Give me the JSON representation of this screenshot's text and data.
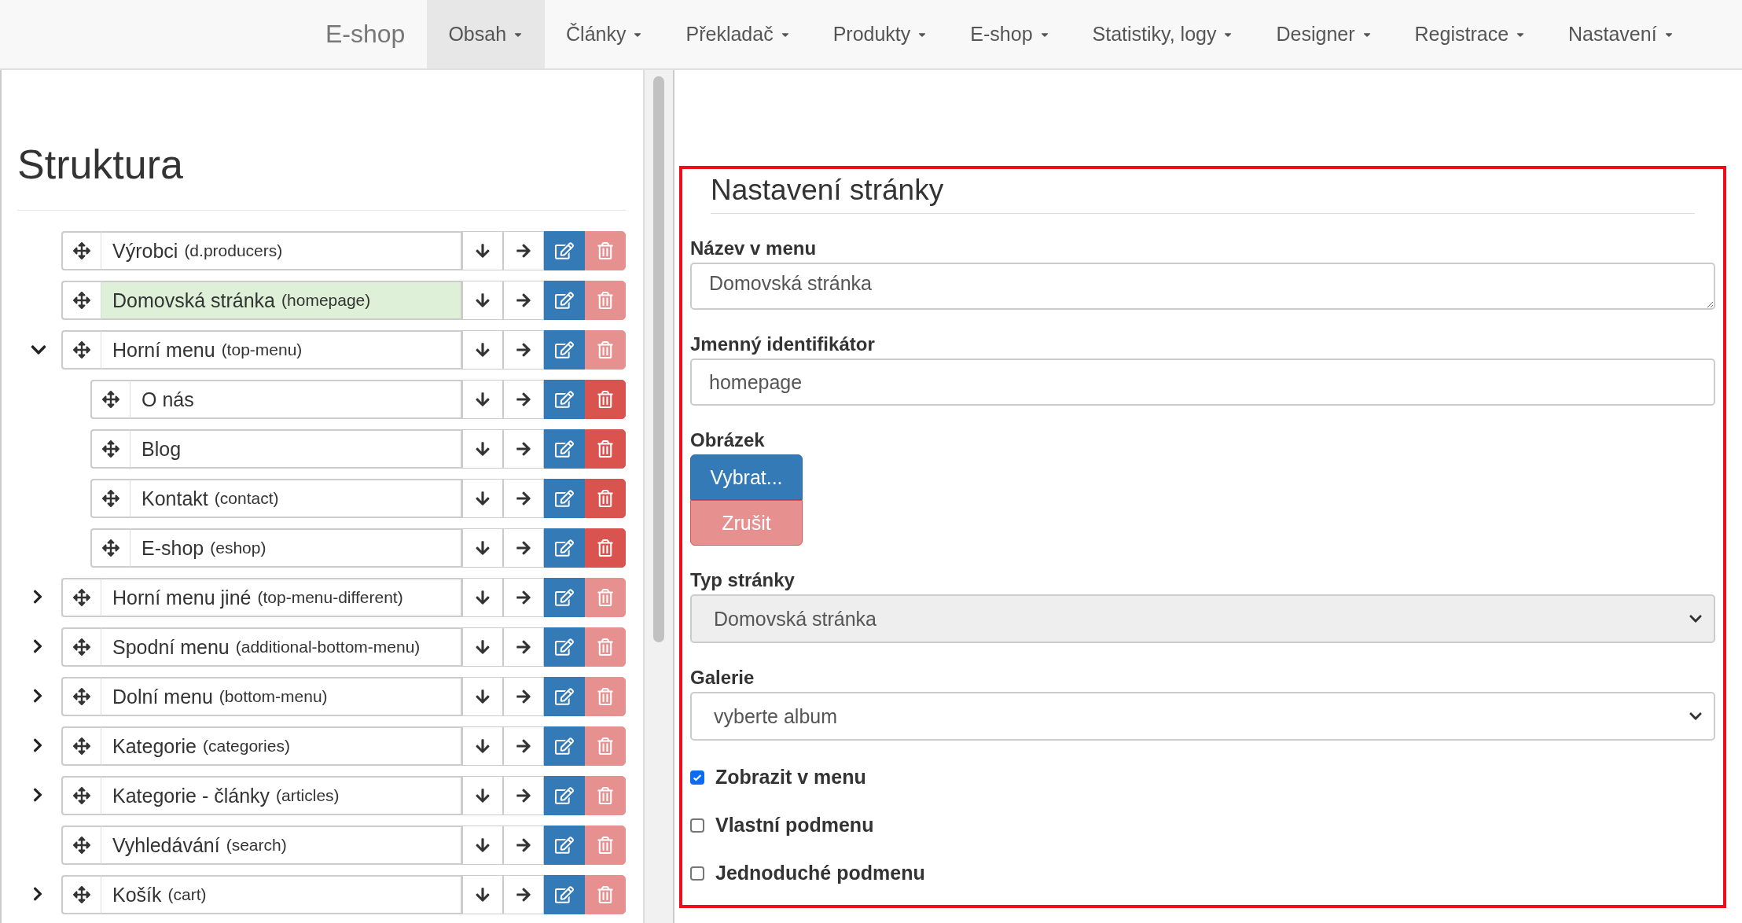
{
  "nav": {
    "brand": "E-shop",
    "items": [
      {
        "label": "Obsah",
        "selected": true
      },
      {
        "label": "Články",
        "selected": false
      },
      {
        "label": "Překladač",
        "selected": false
      },
      {
        "label": "Produkty",
        "selected": false
      },
      {
        "label": "E-shop",
        "selected": false
      },
      {
        "label": "Statistiky, logy",
        "selected": false
      },
      {
        "label": "Designer",
        "selected": false
      },
      {
        "label": "Registrace",
        "selected": false
      },
      {
        "label": "Nastavení",
        "selected": false
      }
    ]
  },
  "structure": {
    "title": "Struktura",
    "items": [
      {
        "name": "Výrobci",
        "slug": "(d.producers)",
        "selected": false,
        "delete_enabled": false
      },
      {
        "name": "Domovská stránka",
        "slug": "(homepage)",
        "selected": true,
        "delete_enabled": false
      },
      {
        "name": "Horní menu",
        "slug": "(top-menu)",
        "expanded": true,
        "selected": false,
        "delete_enabled": false,
        "children": [
          {
            "name": "O nás",
            "selected": false,
            "delete_enabled": true
          },
          {
            "name": "Blog",
            "selected": false,
            "delete_enabled": true
          },
          {
            "name": "Kontakt",
            "slug": "(contact)",
            "selected": false,
            "delete_enabled": true
          },
          {
            "name": "E-shop",
            "slug": "(eshop)",
            "selected": false,
            "delete_enabled": true
          }
        ]
      },
      {
        "name": "Horní menu jiné",
        "slug": "(top-menu-different)",
        "expanded": false,
        "selected": false,
        "delete_enabled": false
      },
      {
        "name": "Spodní menu",
        "slug": "(additional-bottom-menu)",
        "expanded": false,
        "selected": false,
        "delete_enabled": false
      },
      {
        "name": "Dolní menu",
        "slug": "(bottom-menu)",
        "expanded": false,
        "selected": false,
        "delete_enabled": false
      },
      {
        "name": "Kategorie",
        "slug": "(categories)",
        "expanded": false,
        "selected": false,
        "delete_enabled": false
      },
      {
        "name": "Kategorie - články",
        "slug": "(articles)",
        "expanded": false,
        "selected": false,
        "delete_enabled": false
      },
      {
        "name": "Vyhledávání",
        "slug": "(search)",
        "selected": false,
        "delete_enabled": false
      },
      {
        "name": "Košík",
        "slug": "(cart)",
        "expanded": false,
        "selected": false,
        "delete_enabled": false
      }
    ]
  },
  "settings": {
    "title": "Nastavení stránky",
    "menu_name": {
      "label": "Název v menu",
      "value": "Domovská stránka"
    },
    "identifier": {
      "label": "Jmenný identifikátor",
      "value": "homepage"
    },
    "image": {
      "label": "Obrázek",
      "choose": {
        "label": "Vybrat...",
        "disabled": false
      },
      "cancel": {
        "label": "Zrušit",
        "disabled": true
      }
    },
    "page_type": {
      "label": "Typ stránky",
      "value": "Domovská stránka",
      "disabled": true
    },
    "gallery": {
      "label": "Galerie",
      "value": "vyberte album",
      "disabled": false
    },
    "checkboxes": [
      {
        "label": "Zobrazit v menu",
        "checked": true
      },
      {
        "label": "Vlastní podmenu",
        "checked": false
      },
      {
        "label": "Jednoduché podmenu",
        "checked": false
      }
    ]
  }
}
